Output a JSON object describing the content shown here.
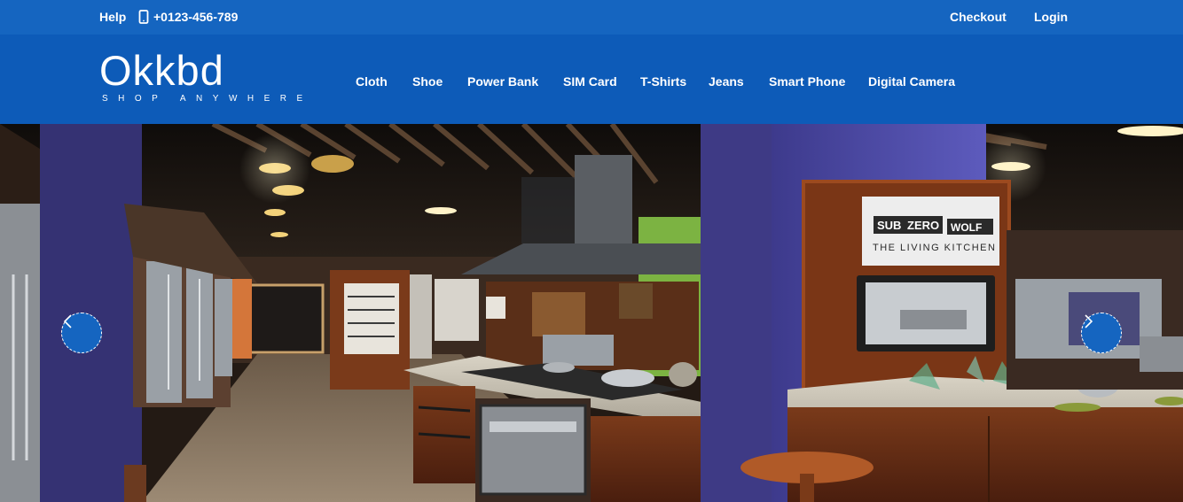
{
  "topbar": {
    "help": "Help",
    "phone": "+0123-456-789",
    "checkout": "Checkout",
    "login": "Login",
    "icons": {
      "phone": "mobile-phone-icon"
    }
  },
  "brand": {
    "name": "Okkbd",
    "tagline": "SHOP ANYWHERE"
  },
  "nav": {
    "items": [
      {
        "label": "Cloth"
      },
      {
        "label": "Shoe"
      },
      {
        "label": "Power Bank"
      },
      {
        "label": "SIM Card"
      },
      {
        "label": "T-Shirts"
      },
      {
        "label": "Jeans"
      },
      {
        "label": "Smart Phone"
      },
      {
        "label": "Digital Camera"
      }
    ]
  },
  "hero": {
    "sign_brand_left": "SUB",
    "sign_brand_mid": "ZERO",
    "sign_brand_right": "WOLF",
    "sign_subtitle": "THE LIVING KITCHEN",
    "icons": {
      "prev": "chevron-left-icon",
      "next": "chevron-right-icon"
    }
  },
  "colors": {
    "topbar": "#1565c0",
    "header": "#0d5bb8",
    "text": "#ffffff"
  }
}
